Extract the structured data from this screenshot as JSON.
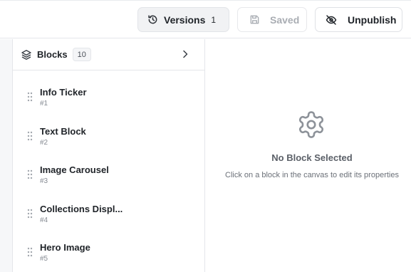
{
  "toolbar": {
    "versions_label": "Versions",
    "versions_count": "1",
    "saved_label": "Saved",
    "unpublish_label": "Unpublish"
  },
  "blocks_panel": {
    "title": "Blocks",
    "count": "10",
    "items": [
      {
        "name": "Info Ticker",
        "number": "#1"
      },
      {
        "name": "Text Block",
        "number": "#2"
      },
      {
        "name": "Image Carousel",
        "number": "#3"
      },
      {
        "name": "Collections Displ...",
        "number": "#4"
      },
      {
        "name": "Hero Image",
        "number": "#5"
      }
    ]
  },
  "properties_panel": {
    "empty_title": "No Block Selected",
    "empty_message": "Click on a block in the canvas to edit its properties"
  },
  "icons": {
    "versions": "history-icon",
    "saved": "save-icon",
    "unpublish": "eye-off-icon",
    "blocks": "layers-icon",
    "expand": "chevron-right-icon",
    "drag": "drag-handle-icon",
    "empty": "gear-icon"
  },
  "colors": {
    "border": "#e4e6ea",
    "muted_text": "#868b93",
    "disabled_text": "#a9adb3",
    "gear_icon": "#8d9299"
  }
}
